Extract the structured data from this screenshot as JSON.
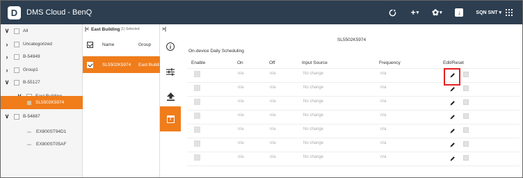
{
  "app": {
    "title": "DMS Cloud - BenQ",
    "logo_letter": "D",
    "user": "SQN SNT"
  },
  "topbar_icons": [
    "sync-icon",
    "add-icon",
    "settings-icon",
    "download-icon",
    "apps-grid-icon"
  ],
  "tree": {
    "items": [
      {
        "label": "All",
        "caret": "∨",
        "active": false
      },
      {
        "label": "Uncategorized",
        "caret": "›",
        "active": false
      },
      {
        "label": "B-54949",
        "caret": "›",
        "active": false
      },
      {
        "label": "Group1",
        "caret": "›",
        "active": false
      },
      {
        "label": "B-55127",
        "caret": "∨",
        "active": false
      },
      {
        "label": "East Building",
        "caret": "∨",
        "active": false
      },
      {
        "label": "SL5502K5974",
        "caret": "",
        "active": true
      },
      {
        "label": "B-54887",
        "caret": "∨",
        "active": false
      },
      {
        "label": "EX800ST94D1",
        "caret": "",
        "active": false
      },
      {
        "label": "EX800ST05AF",
        "caret": "",
        "active": false
      }
    ]
  },
  "middle": {
    "back": "|<",
    "group_title": "East Building",
    "selected_text": "(1) Selected",
    "expand": ">|",
    "col_name": "Name",
    "col_group": "Group",
    "rows": [
      {
        "name": "SL5502K5974",
        "group": "East Building"
      }
    ]
  },
  "panel": {
    "device_title": "SL5502K5974",
    "section_title": "On-device Daily Scheduling",
    "headers": {
      "enable": "Enable",
      "on": "On",
      "off": "Off",
      "input_source": "Input Source",
      "frequency": "Frequency",
      "edit_reset": "Edit/Reset"
    },
    "rows": [
      {
        "on": "n/a",
        "off": "n/a",
        "input_source": "No change",
        "frequency": "n/a"
      },
      {
        "on": "n/a",
        "off": "n/a",
        "input_source": "No change",
        "frequency": "n/a"
      },
      {
        "on": "n/a",
        "off": "n/a",
        "input_source": "No change",
        "frequency": "n/a"
      },
      {
        "on": "n/a",
        "off": "n/a",
        "input_source": "No change",
        "frequency": "n/a"
      },
      {
        "on": "n/a",
        "off": "n/a",
        "input_source": "No change",
        "frequency": "n/a"
      },
      {
        "on": "n/a",
        "off": "n/a",
        "input_source": "No change",
        "frequency": "n/a"
      },
      {
        "on": "n/a",
        "off": "n/a",
        "input_source": "No change",
        "frequency": "n/a"
      }
    ]
  },
  "colors": {
    "topbar": "#2c3e50",
    "accent": "#f07c1a",
    "highlight": "#e41e1e"
  }
}
